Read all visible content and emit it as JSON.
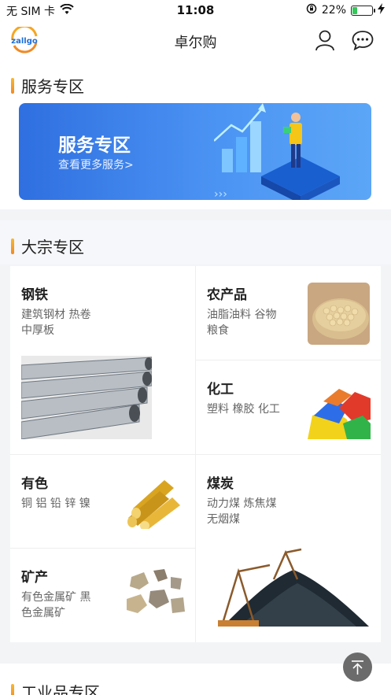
{
  "status_bar": {
    "carrier": "无 SIM 卡",
    "time": "11:08",
    "battery": "22%",
    "battery_level": 0.22
  },
  "navbar": {
    "logo_text": "zallgo",
    "title": "卓尔购"
  },
  "service_section": {
    "title": "服务专区",
    "banner_title": "服务专区",
    "banner_sub": "查看更多服务>"
  },
  "bulk_section": {
    "title": "大宗专区",
    "items": [
      {
        "name": "钢铁",
        "desc": "建筑钢材 热卷 中厚板",
        "desc_l1": "建筑钢材 热卷",
        "desc_l2": "中厚板"
      },
      {
        "name": "农产品",
        "desc": "油脂油料 谷物 粮食",
        "desc_l1": "油脂油料 谷物",
        "desc_l2": "粮食"
      },
      {
        "name": "化工",
        "desc": "塑料 橡胶 化工",
        "desc_l1": "塑料 橡胶 化工",
        "desc_l2": ""
      },
      {
        "name": "有色",
        "desc": "铜 铝 铅 锌 镍",
        "desc_l1": "铜 铝 铅 锌 镍",
        "desc_l2": ""
      },
      {
        "name": "煤炭",
        "desc": "动力煤 炼焦煤 无烟煤",
        "desc_l1": "动力煤 炼焦煤",
        "desc_l2": "无烟煤"
      },
      {
        "name": "矿产",
        "desc": "有色金属矿 黑色金属矿",
        "desc_l1": "有色金属矿 黑",
        "desc_l2": "色金属矿"
      }
    ]
  },
  "industrial_section": {
    "title": "工业品专区"
  },
  "colors": {
    "accent": "#f5a623",
    "banner": "#3b82ee"
  }
}
